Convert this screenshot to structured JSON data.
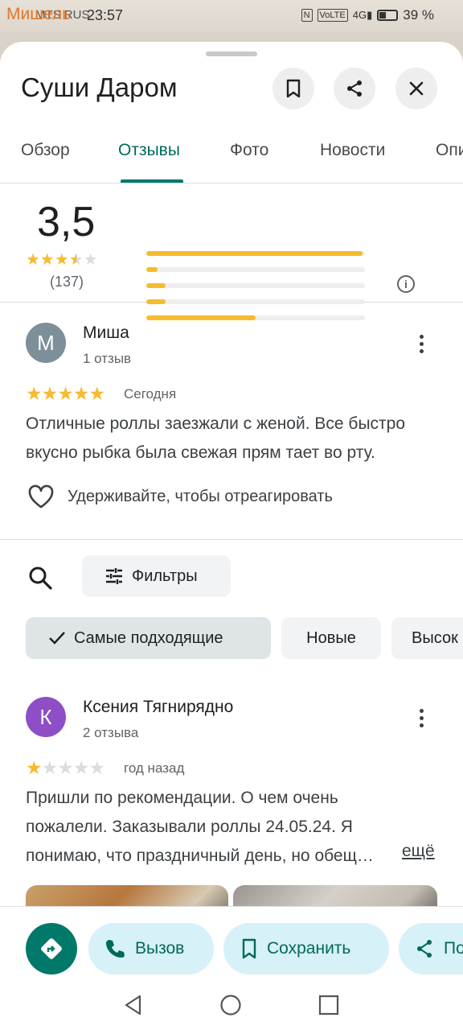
{
  "status_bar": {
    "overlay_text": "Мишель",
    "carrier": "MTS RUS",
    "time": "23:57",
    "battery": "39 %"
  },
  "place": {
    "title": "Суши Даром"
  },
  "tabs": [
    {
      "label": "Обзор"
    },
    {
      "label": "Отзывы"
    },
    {
      "label": "Фото"
    },
    {
      "label": "Новости"
    },
    {
      "label": "Опи"
    }
  ],
  "summary": {
    "rating": "3,5",
    "count": "(137)",
    "distribution": [
      0.99,
      0.05,
      0.09,
      0.09,
      0.5
    ]
  },
  "reviews": [
    {
      "avatar_letter": "М",
      "avatar_color": "#7d8f99",
      "name": "Миша",
      "sub": "1 отзыв",
      "stars": 5,
      "date": "Сегодня",
      "text": "Отличные роллы заезжали с женой. Все быстро вкусно рыбка была свежая прям тает во рту."
    },
    {
      "avatar_letter": "К",
      "avatar_color": "#8e4ec6",
      "name": "Ксения Тягнирядно",
      "sub": "2 отзыва",
      "stars": 1,
      "date": "год назад",
      "text": "Пришли по рекомендации. О чем очень пожалели. Заказывали роллы 24.05.24. Я понимаю, что праздничный день, но обещ…",
      "more": "ещё"
    }
  ],
  "react_label": "Удерживайте, чтобы отреагировать",
  "filters_label": "Фильтры",
  "sort_chips": [
    {
      "label": "Самые подходящие",
      "selected": true
    },
    {
      "label": "Новые",
      "selected": false
    },
    {
      "label": "Высок",
      "selected": false
    }
  ],
  "actions": {
    "call": "Вызов",
    "save": "Сохранить",
    "share": "По"
  },
  "colors": {
    "accent": "#00796b",
    "star": "#f6bb2e"
  }
}
